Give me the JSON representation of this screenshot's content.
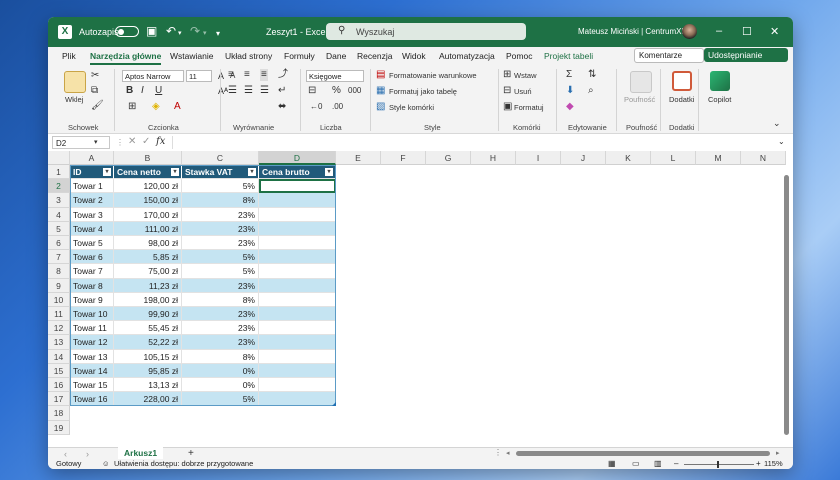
{
  "titlebar": {
    "app_icon": "X",
    "autosave_label": "Autozapis",
    "doc_title": "Zeszyt1  -  Excel",
    "search_placeholder": "Wyszukaj",
    "user_name": "Mateusz Miciński | CentrumXP",
    "minimize": "–",
    "maximize": "☐",
    "close": "✕"
  },
  "menu": {
    "items": [
      "Plik",
      "Narzędzia główne",
      "Wstawianie",
      "Układ strony",
      "Formuły",
      "Dane",
      "Recenzja",
      "Widok",
      "Automatyzacja",
      "Pomoc",
      "Projekt tabeli"
    ],
    "active_index": 1,
    "comments": "Komentarze",
    "share": "Udostępnianie"
  },
  "ribbon": {
    "paste": "Wklej",
    "font_name": "Aptos Narrow",
    "font_size": "11",
    "number_format": "Księgowe",
    "cond_format": "Formatowanie warunkowe",
    "format_table": "Formatuj jako tabelę",
    "cell_styles": "Style komórki",
    "insert": "Wstaw",
    "delete": "Usuń",
    "format": "Formatuj",
    "sensitivity": "Poufność",
    "addins": "Dodatki",
    "copilot": "Copilot",
    "groups": [
      "Schowek",
      "Czcionka",
      "Wyrównanie",
      "Liczba",
      "Style",
      "Komórki",
      "Edytowanie",
      "Poufność",
      "Dodatki"
    ]
  },
  "formula": {
    "name_box": "D2",
    "fx": "fx",
    "value": ""
  },
  "grid": {
    "columns": [
      "A",
      "B",
      "C",
      "D",
      "E",
      "F",
      "G",
      "H",
      "I",
      "J",
      "K",
      "L",
      "M",
      "N"
    ],
    "selected_column": "D",
    "selected_row": "2",
    "rows": [
      "1",
      "2",
      "3",
      "4",
      "5",
      "6",
      "7",
      "8",
      "9",
      "10",
      "11",
      "12",
      "13",
      "14",
      "15",
      "16",
      "17",
      "18",
      "19"
    ],
    "headers": [
      "ID",
      "Cena netto",
      "Stawka VAT",
      "Cena brutto"
    ],
    "data": [
      [
        "Towar 1",
        "120,00 zł",
        "5%",
        ""
      ],
      [
        "Towar 2",
        "150,00 zł",
        "8%",
        ""
      ],
      [
        "Towar 3",
        "170,00 zł",
        "23%",
        ""
      ],
      [
        "Towar 4",
        "111,00 zł",
        "23%",
        ""
      ],
      [
        "Towar 5",
        "98,00 zł",
        "23%",
        ""
      ],
      [
        "Towar 6",
        "5,85 zł",
        "5%",
        ""
      ],
      [
        "Towar 7",
        "75,00 zł",
        "5%",
        ""
      ],
      [
        "Towar 8",
        "11,23 zł",
        "23%",
        ""
      ],
      [
        "Towar 9",
        "198,00 zł",
        "8%",
        ""
      ],
      [
        "Towar 10",
        "99,90 zł",
        "23%",
        ""
      ],
      [
        "Towar 11",
        "55,45 zł",
        "23%",
        ""
      ],
      [
        "Towar 12",
        "52,22 zł",
        "23%",
        ""
      ],
      [
        "Towar 13",
        "105,15 zł",
        "8%",
        ""
      ],
      [
        "Towar 14",
        "95,85 zł",
        "0%",
        ""
      ],
      [
        "Towar 15",
        "13,13 zł",
        "0%",
        ""
      ],
      [
        "Towar 16",
        "228,00 zł",
        "5%",
        ""
      ]
    ]
  },
  "sheets": {
    "active": "Arkusz1",
    "add": "+"
  },
  "status": {
    "ready": "Gotowy",
    "accessibility": "Ułatwienia dostępu: dobrze przygotowane",
    "zoom": "115%"
  },
  "colors": {
    "accent": "#1e7145",
    "table_header": "#215a7a",
    "table_band": "#c5e4f2"
  }
}
